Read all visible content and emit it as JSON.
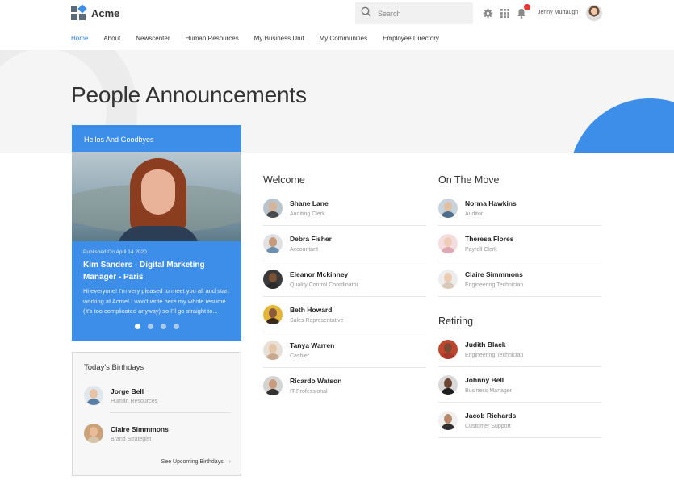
{
  "header": {
    "app_name": "Acme",
    "search_placeholder": "Search",
    "user_name": "Jenny Murtaugh"
  },
  "nav": [
    "Home",
    "About",
    "Newscenter",
    "Human Resources",
    "My Business Unit",
    "My Communities",
    "Employee Directory"
  ],
  "page_title": "People Announcements",
  "hellos": {
    "title": "Hellos And Goodbyes",
    "published": "Published On April 14 2020",
    "headline": "Kim Sanders - Digital Marketing Manager - Paris",
    "excerpt": "Hi everyone! I'm very pleased to meet you all and start working at Acme! I won't write here my whole resume (it's too complicated anyway) so I'll go straight to...",
    "slides": 4,
    "active_slide": 1
  },
  "birthdays": {
    "title": "Today's Birthdays",
    "people": [
      {
        "name": "Jorge Bell",
        "role": "Human Resources"
      },
      {
        "name": "Claire Simmmons",
        "role": "Brand Strategist"
      }
    ],
    "link": "See Upcoming Birthdays"
  },
  "welcome": {
    "title": "Welcome",
    "people": [
      {
        "name": "Shane Lane",
        "role": "Auditing Clerk"
      },
      {
        "name": "Debra Fisher",
        "role": "Accountant"
      },
      {
        "name": "Eleanor Mckinney",
        "role": "Quality Control Coordinator"
      },
      {
        "name": "Beth Howard",
        "role": "Sales Representative"
      },
      {
        "name": "Tanya Warren",
        "role": "Cashier"
      },
      {
        "name": "Ricardo Watson",
        "role": "IT Professional"
      }
    ]
  },
  "on_the_move": {
    "title": "On The Move",
    "people": [
      {
        "name": "Norma Hawkins",
        "role": "Auditor"
      },
      {
        "name": "Theresa Flores",
        "role": "Payroll Clerk"
      },
      {
        "name": "Claire Simmmons",
        "role": "Engineering Technician"
      }
    ]
  },
  "retiring": {
    "title": "Retiring",
    "people": [
      {
        "name": "Judith Black",
        "role": "Engineering Technician"
      },
      {
        "name": "Johnny Bell",
        "role": "Business Manager"
      },
      {
        "name": "Jacob Richards",
        "role": "Customer Support"
      }
    ]
  },
  "colors": {
    "accent": "#3c8ee8",
    "notification": "#e53935"
  }
}
